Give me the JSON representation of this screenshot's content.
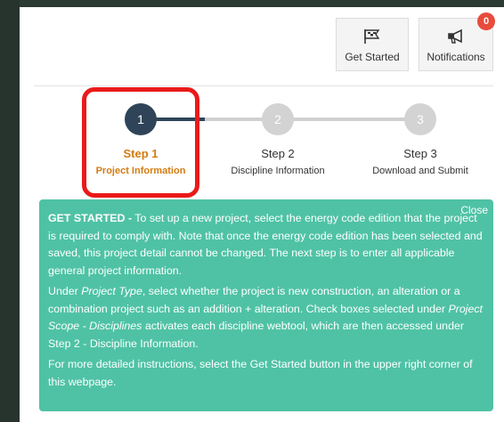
{
  "header": {
    "get_started_label": "Get Started",
    "notifications_label": "Notifications",
    "notifications_count": "0"
  },
  "stepper": {
    "steps": [
      {
        "number": "1",
        "title": "Step 1",
        "subtitle": "Project Information",
        "state": "active"
      },
      {
        "number": "2",
        "title": "Step 2",
        "subtitle": "Discipline Information",
        "state": "inactive"
      },
      {
        "number": "3",
        "title": "Step 3",
        "subtitle": "Download and Submit",
        "state": "inactive"
      }
    ]
  },
  "info_panel": {
    "close_label": "Close",
    "heading": "GET STARTED -",
    "p1_text": " To set up a new project, select the energy code edition that the project is required to comply with. Note that once the energy code edition has been selected and saved, this project detail cannot be changed. The next step is to enter all applicable general project information.",
    "p2_a": "Under ",
    "p2_em1": "Project Type",
    "p2_b": ", select whether the project is new construction, an alteration or a combination project such as an addition + alteration. Check boxes selected under ",
    "p2_em2": "Project Scope - Disciplines",
    "p2_c": " activates each discipline webtool, which are then accessed under Step 2 - Discipline Information.",
    "p3_text": "For more detailed instructions, select the Get Started button in the upper right corner of this webpage."
  },
  "colors": {
    "accent_active_step": "#2f4458",
    "active_step_text": "#d27c12",
    "info_bg": "#4fc2a5",
    "highlight": "#ea1a1a",
    "badge": "#e74c3c"
  },
  "icons": {
    "get_started": "flag-icon",
    "notifications": "megaphone-icon"
  }
}
